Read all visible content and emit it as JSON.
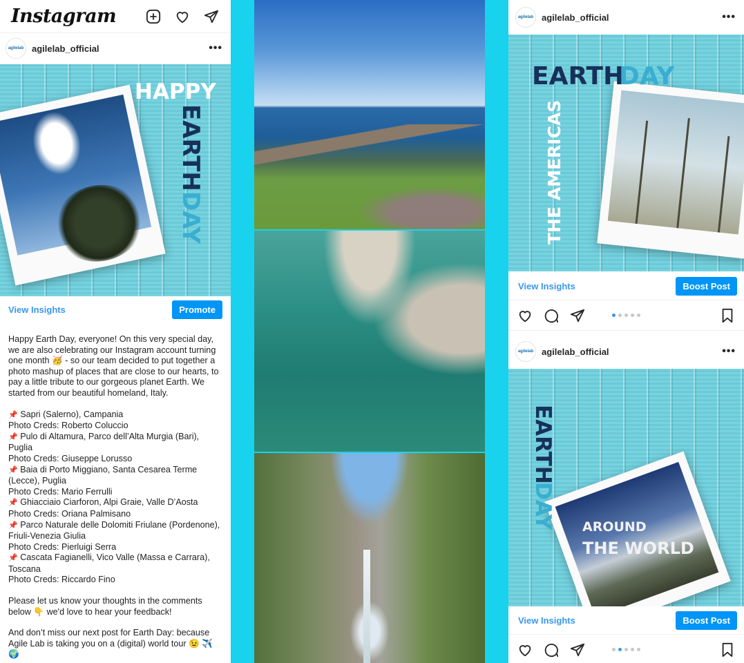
{
  "app": {
    "logo": "Instagram"
  },
  "left_post": {
    "username": "agilelab_official",
    "avatar_text": "agilelab",
    "menu": "•••",
    "image": {
      "line1": "HAPPY",
      "word_a": "EARTH",
      "word_b": "DAY"
    },
    "view_insights": "View Insights",
    "promote": "Promote",
    "caption": {
      "intro": "Happy Earth Day, everyone! On this very special day, we are also celebrating our Instagram account turning one month 🥳 - so our team decided to put together a photo mashup of places that are close to our hearts, to pay a little tribute to our gorgeous planet Earth. We started from our beautiful homeland, Italy.",
      "places": [
        {
          "place": "Sapri (Salerno), Campania",
          "creds": "Photo Creds: Roberto Coluccio"
        },
        {
          "place": "Pulo di Altamura, Parco dell’Alta Murgia (Bari), Puglia",
          "creds": "Photo Creds: Giuseppe Lorusso"
        },
        {
          "place": "Baia di Porto Miggiano, Santa Cesarea Terme (Lecce), Puglia",
          "creds": "Photo Creds: Mario Ferrulli"
        },
        {
          "place": "Ghiacciaio Ciarforon, Alpi Graie, Valle D’Aosta",
          "creds": "Photo Creds: Oriana Palmisano"
        },
        {
          "place": "Parco Naturale delle Dolomiti Friulane (Pordenone), Friuli-Venezia Giulia",
          "creds": "Photo Creds: Pierluigi Serra"
        },
        {
          "place": "Cascata Fagianelli, Vico Valle (Massa e Carrara), Toscana",
          "creds": "Photo Creds: Riccardo Fino"
        }
      ],
      "pin": "📌",
      "feedback": "Please let us know your thoughts in the comments below 👇 we'd love to hear your feedback!",
      "closing": "And don’t miss our next post for Earth Day: because Agile Lab is taking you on a (digital) world tour 😉 ✈️ 🌍"
    }
  },
  "right_posts": [
    {
      "username": "agilelab_official",
      "avatar_text": "agilelab",
      "menu": "•••",
      "image": {
        "word_a": "EARTH",
        "word_b": "DAY",
        "vertical": "THE AMERICAS"
      },
      "view_insights": "View Insights",
      "boost": "Boost Post",
      "carousel": {
        "count": 5,
        "active": 1
      }
    },
    {
      "username": "agilelab_official",
      "avatar_text": "agilelab",
      "menu": "•••",
      "image": {
        "word_a": "EARTH",
        "word_b": "DAY",
        "line1": "AROUND",
        "line2": "THE WORLD"
      },
      "view_insights": "View Insights",
      "boost": "Boost Post",
      "carousel": {
        "count": 5,
        "active": 1
      }
    }
  ],
  "icons": [
    "new-post-icon",
    "heart-icon",
    "direct-icon",
    "comment-icon",
    "share-icon",
    "bookmark-icon",
    "more-icon"
  ],
  "colors": {
    "accent_blue": "#0095f6",
    "link_blue": "#3897f0",
    "background_cyan": "#19d3ee",
    "navy_text": "#17305a"
  }
}
